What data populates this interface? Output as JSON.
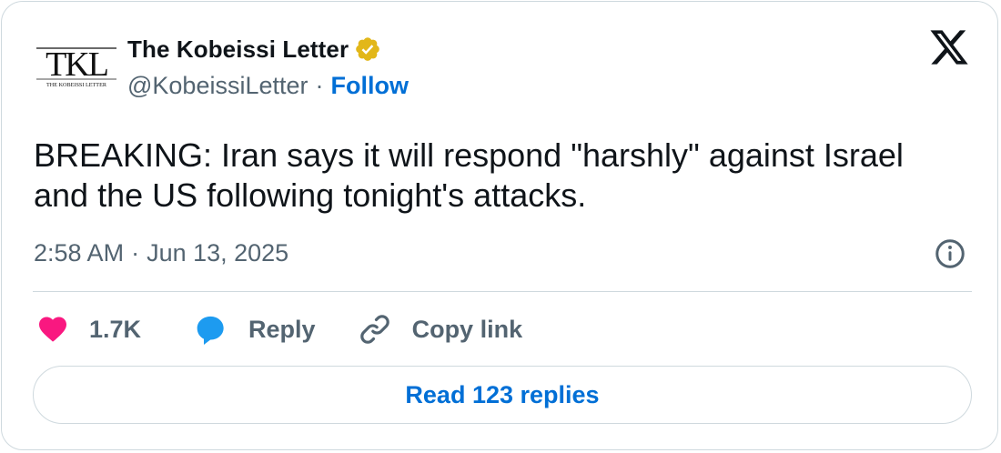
{
  "author": {
    "avatar_text": "TKL",
    "avatar_subtext": "THE KOBEISSI LETTER",
    "display_name": "The Kobeissi Letter",
    "handle": "@KobeissiLetter",
    "separator": "·",
    "follow_label": "Follow",
    "verified": true,
    "badge_color": "#e2b719"
  },
  "platform_icon": "x-logo-icon",
  "tweet": {
    "text": "BREAKING: Iran says it will respond \"harshly\" against Israel and the US following tonight's attacks."
  },
  "meta": {
    "time": "2:58 AM",
    "separator": "·",
    "date": "Jun 13, 2025"
  },
  "actions": {
    "likes_count": "1.7K",
    "reply_label": "Reply",
    "copy_link_label": "Copy link"
  },
  "read_replies_label": "Read 123 replies",
  "colors": {
    "link_blue": "#006fd6",
    "like_pink": "#f91880",
    "reply_blue": "#1d9bf0",
    "secondary_text": "#536471",
    "border": "#cfd9de"
  }
}
